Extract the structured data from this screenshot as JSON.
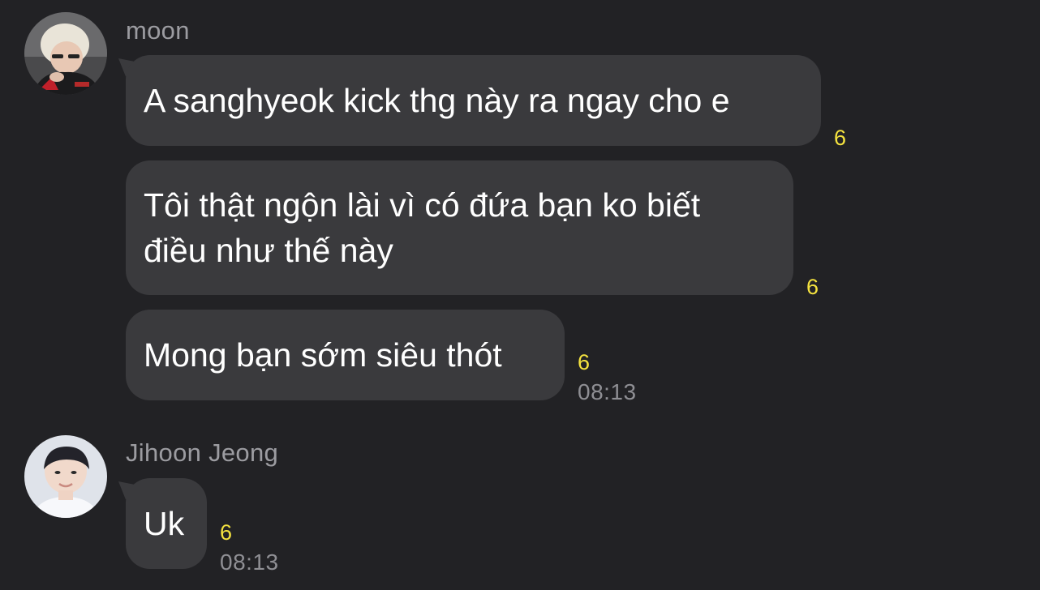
{
  "conversation": {
    "groups": [
      {
        "sender": "moon",
        "avatar_icon": "profile-photo-blond-person",
        "messages": [
          {
            "text": "A sanghyeok kick thg này ra ngay cho e",
            "unread": "6"
          },
          {
            "text": "Tôi thật ngộn lài vì có đứa bạn ko biết\nđiều như thế này",
            "unread": "6"
          },
          {
            "text": "Mong bạn sớm siêu thót",
            "unread": "6",
            "time": "08:13"
          }
        ]
      },
      {
        "sender": "Jihoon Jeong",
        "avatar_icon": "profile-photo-dark-hair-person",
        "messages": [
          {
            "text": "Uk",
            "unread": "6",
            "time": "08:13"
          }
        ]
      }
    ]
  },
  "colors": {
    "background": "#222225",
    "bubble": "#3a3a3d",
    "unread_count": "#f5e33f",
    "sender_name": "#9c9ca1",
    "timestamp": "#8f8f94",
    "message_text": "#ffffff"
  }
}
